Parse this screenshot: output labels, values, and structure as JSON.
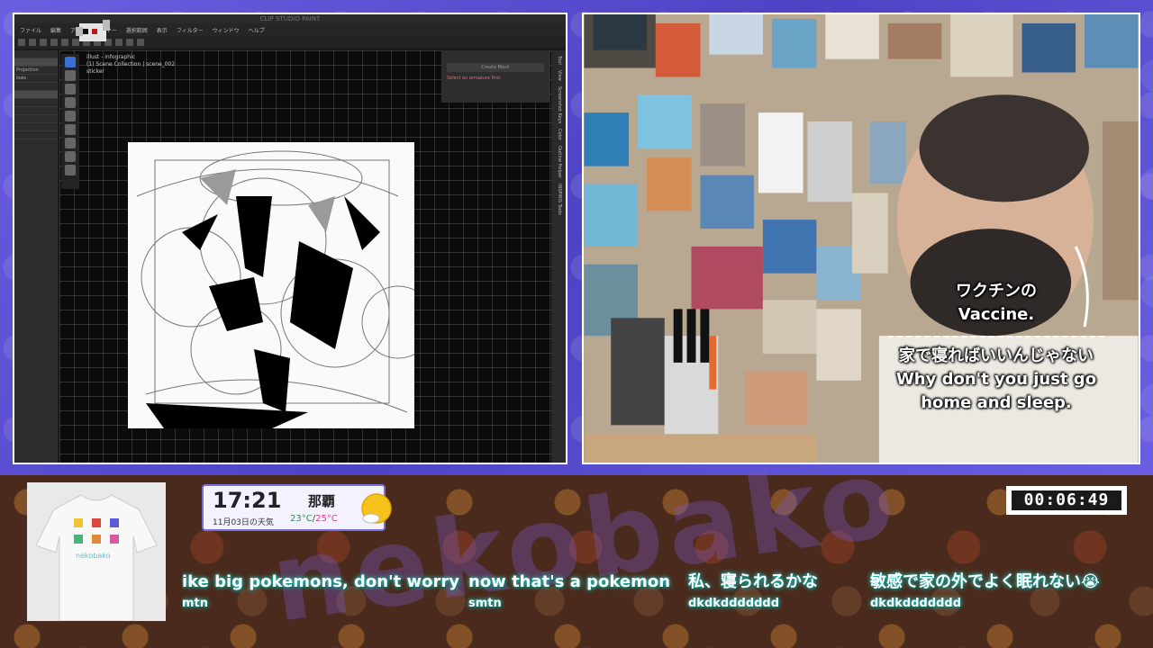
{
  "colors": {
    "frame_purple": "#5b4fd1",
    "bottom_brown": "#4a2a1c",
    "chat_glow": "#2ad7c9",
    "temp_low": "#2e8b57",
    "temp_high": "#d8408a"
  },
  "art_app": {
    "title": "CLIP STUDIO PAINT",
    "menu": [
      "ファイル",
      "編集",
      "アニメ",
      "レイヤー",
      "選択範囲",
      "表示",
      "フィルター",
      "ウィンドウ",
      "ヘルプ"
    ],
    "doc_info": [
      "illust - infographic",
      "(1) Scene Collection | scene_002",
      "sticker"
    ],
    "left_props": [
      "",
      "",
      "Projection",
      "lows",
      "",
      "",
      "",
      "",
      "",
      "",
      ""
    ],
    "popup_button": "Create Mesh",
    "popup_warning": "Select an armature first",
    "side_tabs": [
      "Tool",
      "View",
      "Screenshot Keys",
      "Color",
      "Outline Helper",
      "INSPIRIS Tools"
    ]
  },
  "webcam": {
    "subtitle_jp_1": "ワクチンの",
    "subtitle_en_1": "Vaccine.",
    "subtitle_jp_2": "家で寝ればいいんじゃない",
    "subtitle_en_2a": "Why don't you just go",
    "subtitle_en_2b": "home and sleep."
  },
  "weather": {
    "time": "17:21",
    "date": "11月03日の天気",
    "city": "那覇",
    "temp_low": "23°C",
    "temp_sep": "/",
    "temp_high": "25°C",
    "icon": "sun-cloud-icon"
  },
  "timer": {
    "value": "00:06:49"
  },
  "shirt": {
    "brand": "nekobako"
  },
  "brand_bg": "nekobako",
  "chat": [
    {
      "message": "ike big pokemons, don't worry",
      "user": "mtn"
    },
    {
      "message": "now that's a pokemon",
      "user": "smtn"
    },
    {
      "message": "私、寝られるかな",
      "user": "dkdkddddddd"
    },
    {
      "message": "敏感で家の外でよく眠れない😭",
      "user": "dkdkddddddd"
    }
  ]
}
